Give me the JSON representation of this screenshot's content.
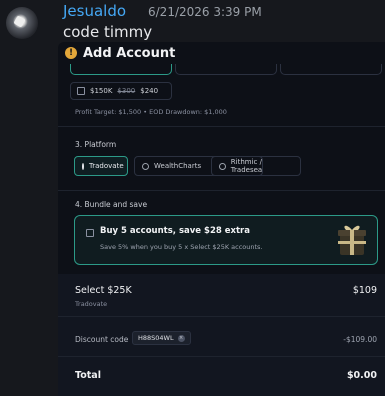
{
  "message": {
    "username": "Jesualdo",
    "timestamp": "6/21/2026 3:39 PM",
    "text": "code timmy"
  },
  "modal": {
    "title": "Add Account",
    "price_option": {
      "size": "$150K",
      "old_price": "$300",
      "new_price": "$240"
    },
    "profit_info": "Profit Target: $1,500 • EOD Drawdown: $1,000",
    "platform": {
      "heading": "3. Platform",
      "options": [
        "Tradovate",
        "WealthCharts",
        "Rithmic / Tradesea"
      ],
      "selected": "Tradovate"
    },
    "bundle": {
      "heading": "4. Bundle and save",
      "title": "Buy 5 accounts, save $28 extra",
      "subtitle": "Save 5% when you buy 5 x Select $25K accounts."
    },
    "summary": {
      "item_name": "Select $25K",
      "item_price": "$109",
      "item_platform": "Tradovate",
      "discount_label": "Discount code",
      "discount_code": "H88S04WL",
      "discount_value": "-$109.00",
      "total_label": "Total",
      "total_value": "$0.00"
    }
  },
  "colors": {
    "accent": "#2c9a88",
    "link": "#45a8f5",
    "background": "#0d1017"
  }
}
